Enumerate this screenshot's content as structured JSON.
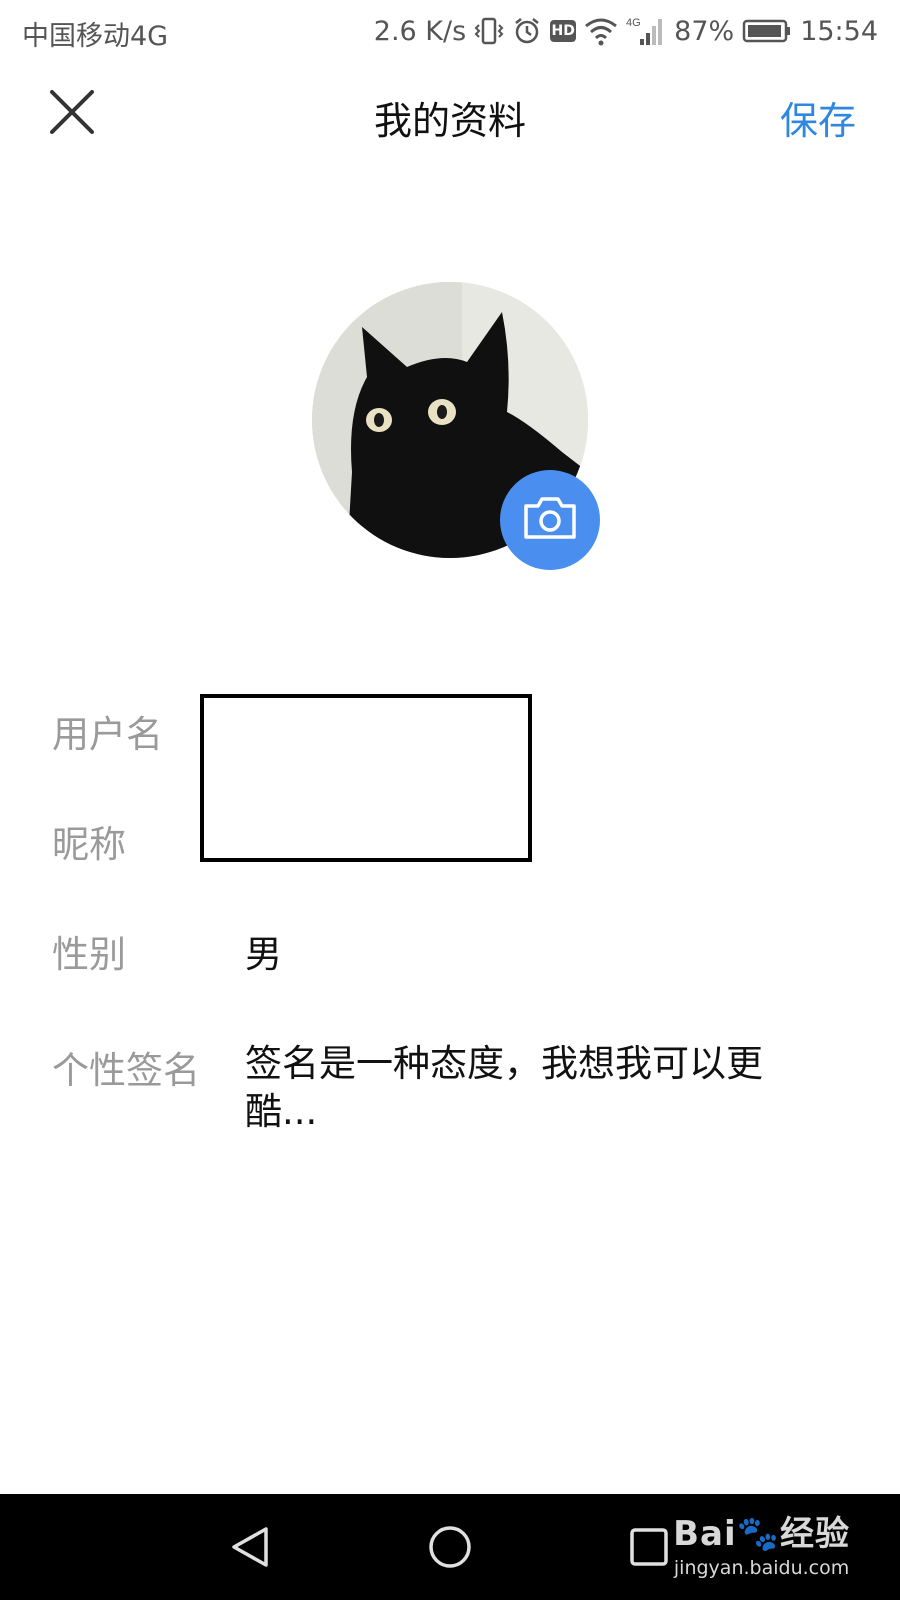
{
  "status_bar": {
    "carrier": "中国移动4G",
    "speed": "2.6 K/s",
    "network": "4G",
    "battery": "87%",
    "time": "15:54"
  },
  "header": {
    "title": "我的资料",
    "save_label": "保存"
  },
  "profile": {
    "fields": [
      {
        "label": "用户名",
        "value": ""
      },
      {
        "label": "昵称",
        "value": ""
      },
      {
        "label": "性别",
        "value": "男"
      },
      {
        "label": "个性签名",
        "value": "签名是一种态度，我想我可以更酷..."
      }
    ]
  },
  "watermark": {
    "logo": "Bai🐾经验",
    "url": "jingyan.baidu.com"
  },
  "colors": {
    "accent": "#2f87df",
    "camera_button": "#4a8ff0",
    "label_gray": "#9a9a9a"
  },
  "icons": {
    "close": "close-icon",
    "camera": "camera-icon",
    "back": "back-triangle-icon",
    "home": "home-circle-icon",
    "recents": "recents-square-icon"
  }
}
